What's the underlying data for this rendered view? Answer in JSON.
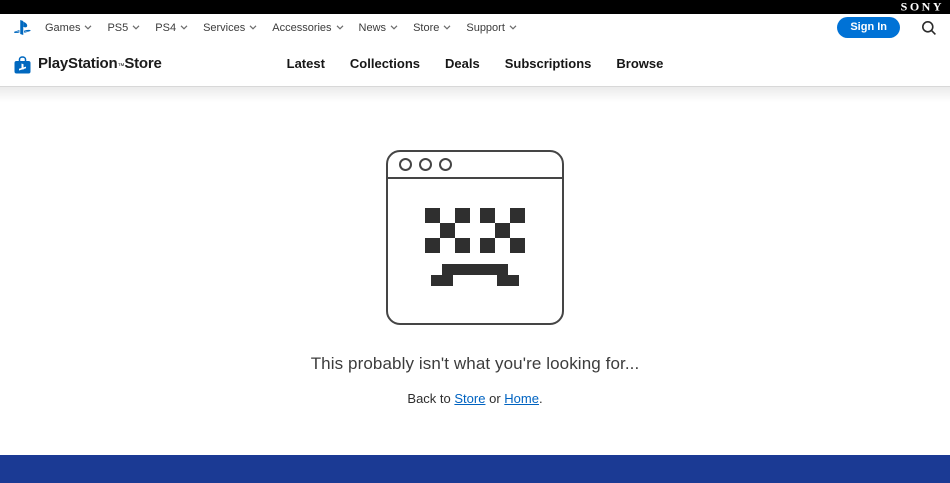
{
  "sony_bar": {
    "logo": "SONY"
  },
  "top_nav": {
    "items": [
      "Games",
      "PS5",
      "PS4",
      "Services",
      "Accessories",
      "News",
      "Store",
      "Support"
    ],
    "sign_in_label": "Sign In"
  },
  "store_nav": {
    "brand": {
      "name": "PlayStation",
      "tm": "™",
      "suffix": "Store"
    },
    "links": [
      "Latest",
      "Collections",
      "Deals",
      "Subscriptions",
      "Browse"
    ]
  },
  "content": {
    "message": "This probably isn't what you're looking for...",
    "back_prefix": "Back to",
    "store_link": "Store",
    "conjunction": "or",
    "home_link": "Home",
    "period": "."
  },
  "colors": {
    "accent_blue": "#0072d6",
    "brand_blue": "#0068bf",
    "link_blue": "#0063c1",
    "footer_blue": "#1b3a94",
    "outline_gray": "#454545"
  }
}
